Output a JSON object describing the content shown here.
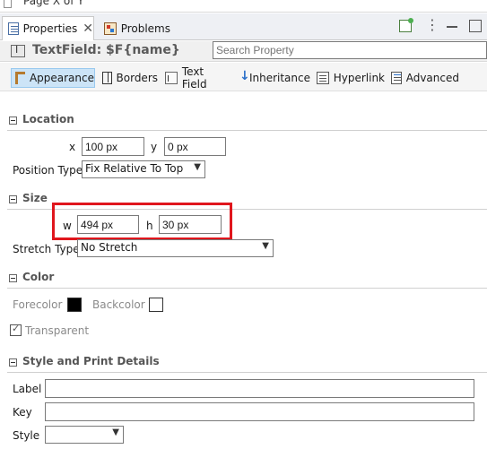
{
  "top_strip": {
    "text": "Page X of Y"
  },
  "tabs": [
    {
      "label": "Properties",
      "icon": "properties-icon",
      "active": true,
      "close": "✕"
    },
    {
      "label": "Problems",
      "icon": "problems-icon",
      "active": false
    }
  ],
  "view_toolbar": [
    "pin-icon",
    "view-menu-icon",
    "minimize-icon",
    "maximize-icon"
  ],
  "header": {
    "title": "TextField: $F{name}",
    "search_placeholder": "Search Property"
  },
  "subtabs": [
    {
      "label": "Appearance",
      "icon": "appearance-icon",
      "selected": true
    },
    {
      "label": "Borders",
      "icon": "borders-icon"
    },
    {
      "label": "Text Field",
      "icon": "text-field-icon"
    },
    {
      "label": "Inheritance",
      "icon": "inheritance-icon"
    },
    {
      "label": "Hyperlink",
      "icon": "hyperlink-icon"
    },
    {
      "label": "Advanced",
      "icon": "advanced-icon"
    }
  ],
  "sections": {
    "location": {
      "title": "Location",
      "x_label": "x",
      "x_value": "100 px",
      "y_label": "y",
      "y_value": "0 px",
      "position_type_label": "Position Type",
      "position_type_value": "Fix Relative To Top"
    },
    "size": {
      "title": "Size",
      "w_label": "w",
      "w_value": "494 px",
      "h_label": "h",
      "h_value": "30 px",
      "stretch_type_label": "Stretch Type",
      "stretch_type_value": "No Stretch"
    },
    "color": {
      "title": "Color",
      "forecolor_label": "Forecolor",
      "forecolor": "#000000",
      "backcolor_label": "Backcolor",
      "backcolor": "#ffffff",
      "transparent_label": "Transparent",
      "transparent_checked": true
    },
    "style": {
      "title": "Style and Print Details",
      "label_label": "Label",
      "label_value": "",
      "key_label": "Key",
      "key_value": "",
      "style_label": "Style",
      "style_value": ""
    }
  },
  "colors": {
    "highlight_border": "#e0161d",
    "selected_tab_bg": "#cce4f7"
  }
}
